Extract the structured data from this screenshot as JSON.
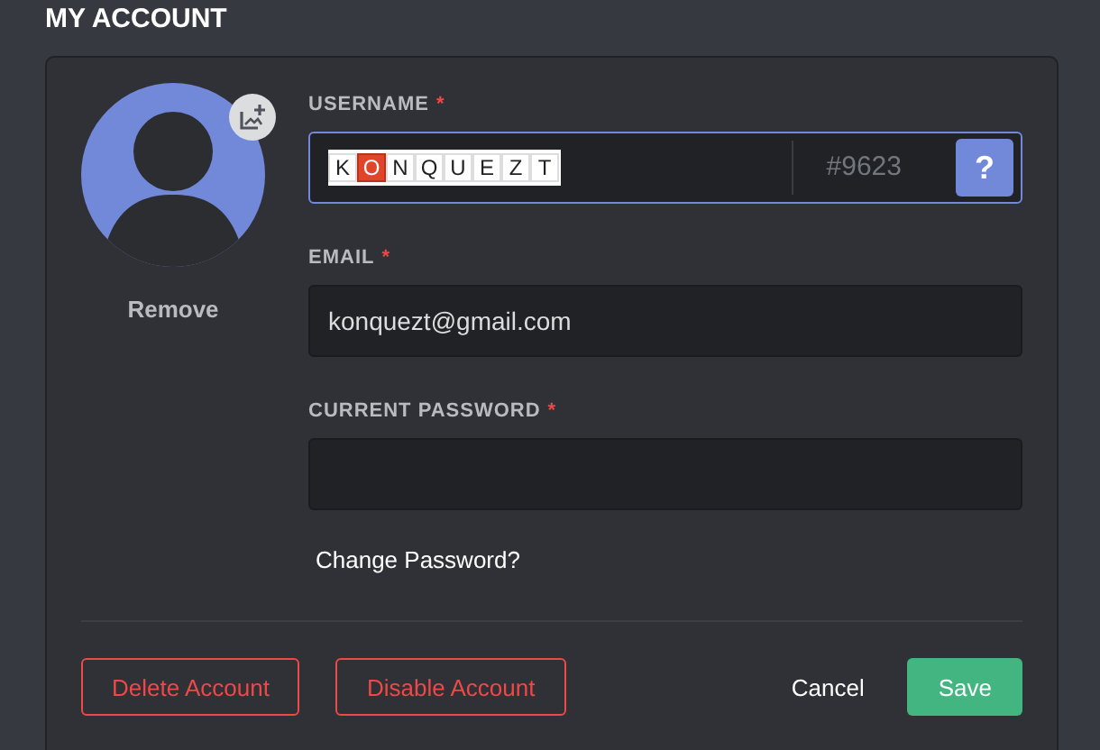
{
  "title": "MY ACCOUNT",
  "avatar": {
    "remove_label": "Remove"
  },
  "username": {
    "label": "USERNAME",
    "required_mark": "*",
    "focused": true,
    "letters": [
      {
        "char": "K",
        "highlighted": false
      },
      {
        "char": "O",
        "highlighted": true
      },
      {
        "char": "N",
        "highlighted": false
      },
      {
        "char": "Q",
        "highlighted": false
      },
      {
        "char": "U",
        "highlighted": false
      },
      {
        "char": "E",
        "highlighted": false
      },
      {
        "char": "Z",
        "highlighted": false
      },
      {
        "char": "T",
        "highlighted": false
      }
    ],
    "discriminator": "#9623",
    "help": "?"
  },
  "email": {
    "label": "EMAIL",
    "required_mark": "*",
    "value": "konquezt@gmail.com"
  },
  "password": {
    "label": "CURRENT PASSWORD",
    "required_mark": "*"
  },
  "change_password": "Change Password?",
  "buttons": [
    {
      "label": "Delete Account",
      "kind": "danger"
    },
    {
      "label": "Disable Account",
      "kind": "danger"
    },
    {
      "label": "Cancel",
      "kind": "link"
    },
    {
      "label": "Save",
      "kind": "primary"
    }
  ]
}
